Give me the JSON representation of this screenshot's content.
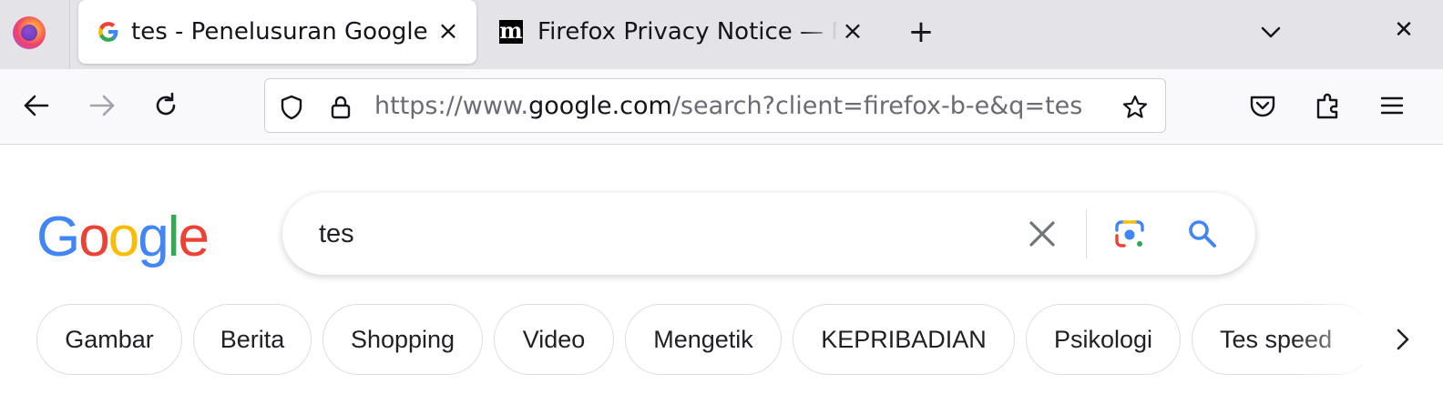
{
  "tabs": [
    {
      "title": "tes - Penelusuran Google",
      "active": true
    },
    {
      "title": "Firefox Privacy Notice — Mozilla",
      "active": false
    }
  ],
  "urlbar": {
    "prefix": "https://www.",
    "host": "google.com",
    "path": "/search?client=firefox-b-e&q=tes"
  },
  "search": {
    "query": "tes"
  },
  "chips": [
    "Gambar",
    "Berita",
    "Shopping",
    "Video",
    "Mengetik",
    "KEPRIBADIAN",
    "Psikologi",
    "Tes speed"
  ],
  "colors": {
    "google_blue": "#4285f4",
    "google_red": "#ea4335",
    "google_yellow": "#fbbc05",
    "google_green": "#34a853"
  }
}
